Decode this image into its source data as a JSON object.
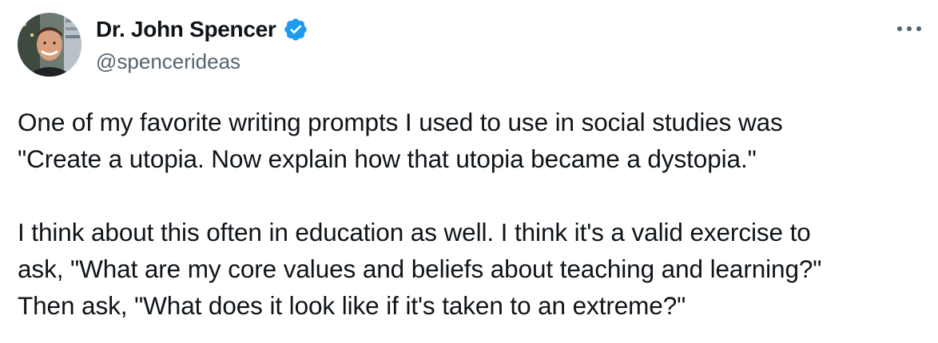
{
  "author": {
    "display_name": "Dr. John Spencer",
    "handle": "@spencerideas",
    "verified": true,
    "verified_color": "#1d9bf0"
  },
  "icons": {
    "verified": "verified-badge-icon",
    "more": "more-horizontal-icon"
  },
  "tweet": {
    "paragraph1": [
      "One of my favorite writing prompts I used to use in social studies was",
      "\"Create a utopia. Now explain how that utopia became a dystopia.\""
    ],
    "paragraph2": [
      "I think about this often in education as well. I think it's a valid exercise to",
      "ask, \"What are my core values and beliefs about teaching and learning?\"",
      "Then ask, \"What does it look like if it's taken to an extreme?\""
    ]
  },
  "colors": {
    "text": "#0f1419",
    "secondary": "#536471",
    "accent": "#1d9bf0"
  }
}
